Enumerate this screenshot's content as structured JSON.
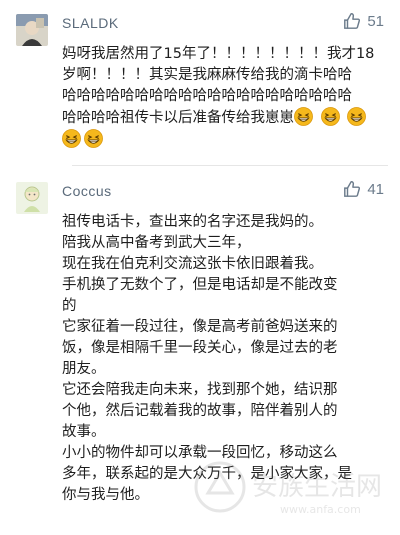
{
  "comments": [
    {
      "username": "SLALDK",
      "likes": "51",
      "lines": [
        "妈呀我居然用了15年了！！！！！！！！我才18",
        "岁啊！！！！其实是我麻麻传给我的滴卡哈哈",
        "哈哈哈哈哈哈哈哈哈哈哈哈哈哈哈哈哈哈哈哈",
        "哈哈哈哈祖传卡以后准备传给我崽崽"
      ],
      "emoji": "grinning-squint-face"
    },
    {
      "username": "Coccus",
      "likes": "41",
      "lines": [
        "祖传电话卡，查出来的名字还是我妈的。",
        "陪我从高中备考到武大三年，",
        "现在我在伯克利交流这张卡依旧跟着我。",
        "手机换了无数个了，但是电话却是不能改变",
        "的",
        "它家征着一段过往，像是高考前爸妈送来的",
        "饭，像是相隔千里一段关心，像是过去的老",
        "朋友。",
        "它还会陪我走向未来，找到那个她，结识那",
        "个他，然后记载着我的故事，陪伴着别人的",
        "故事。",
        "小小的物件却可以承载一段回忆，移动这么",
        "多年，联系起的是大众万千，是小家大家，是",
        "你与我与他。"
      ]
    }
  ],
  "watermark": {
    "text": "安族生活网",
    "sub": "www.anfa.com"
  },
  "colors": {
    "username": "#5a6a7a",
    "like": "#6b7b8b",
    "emoji": "#f5b81c"
  }
}
